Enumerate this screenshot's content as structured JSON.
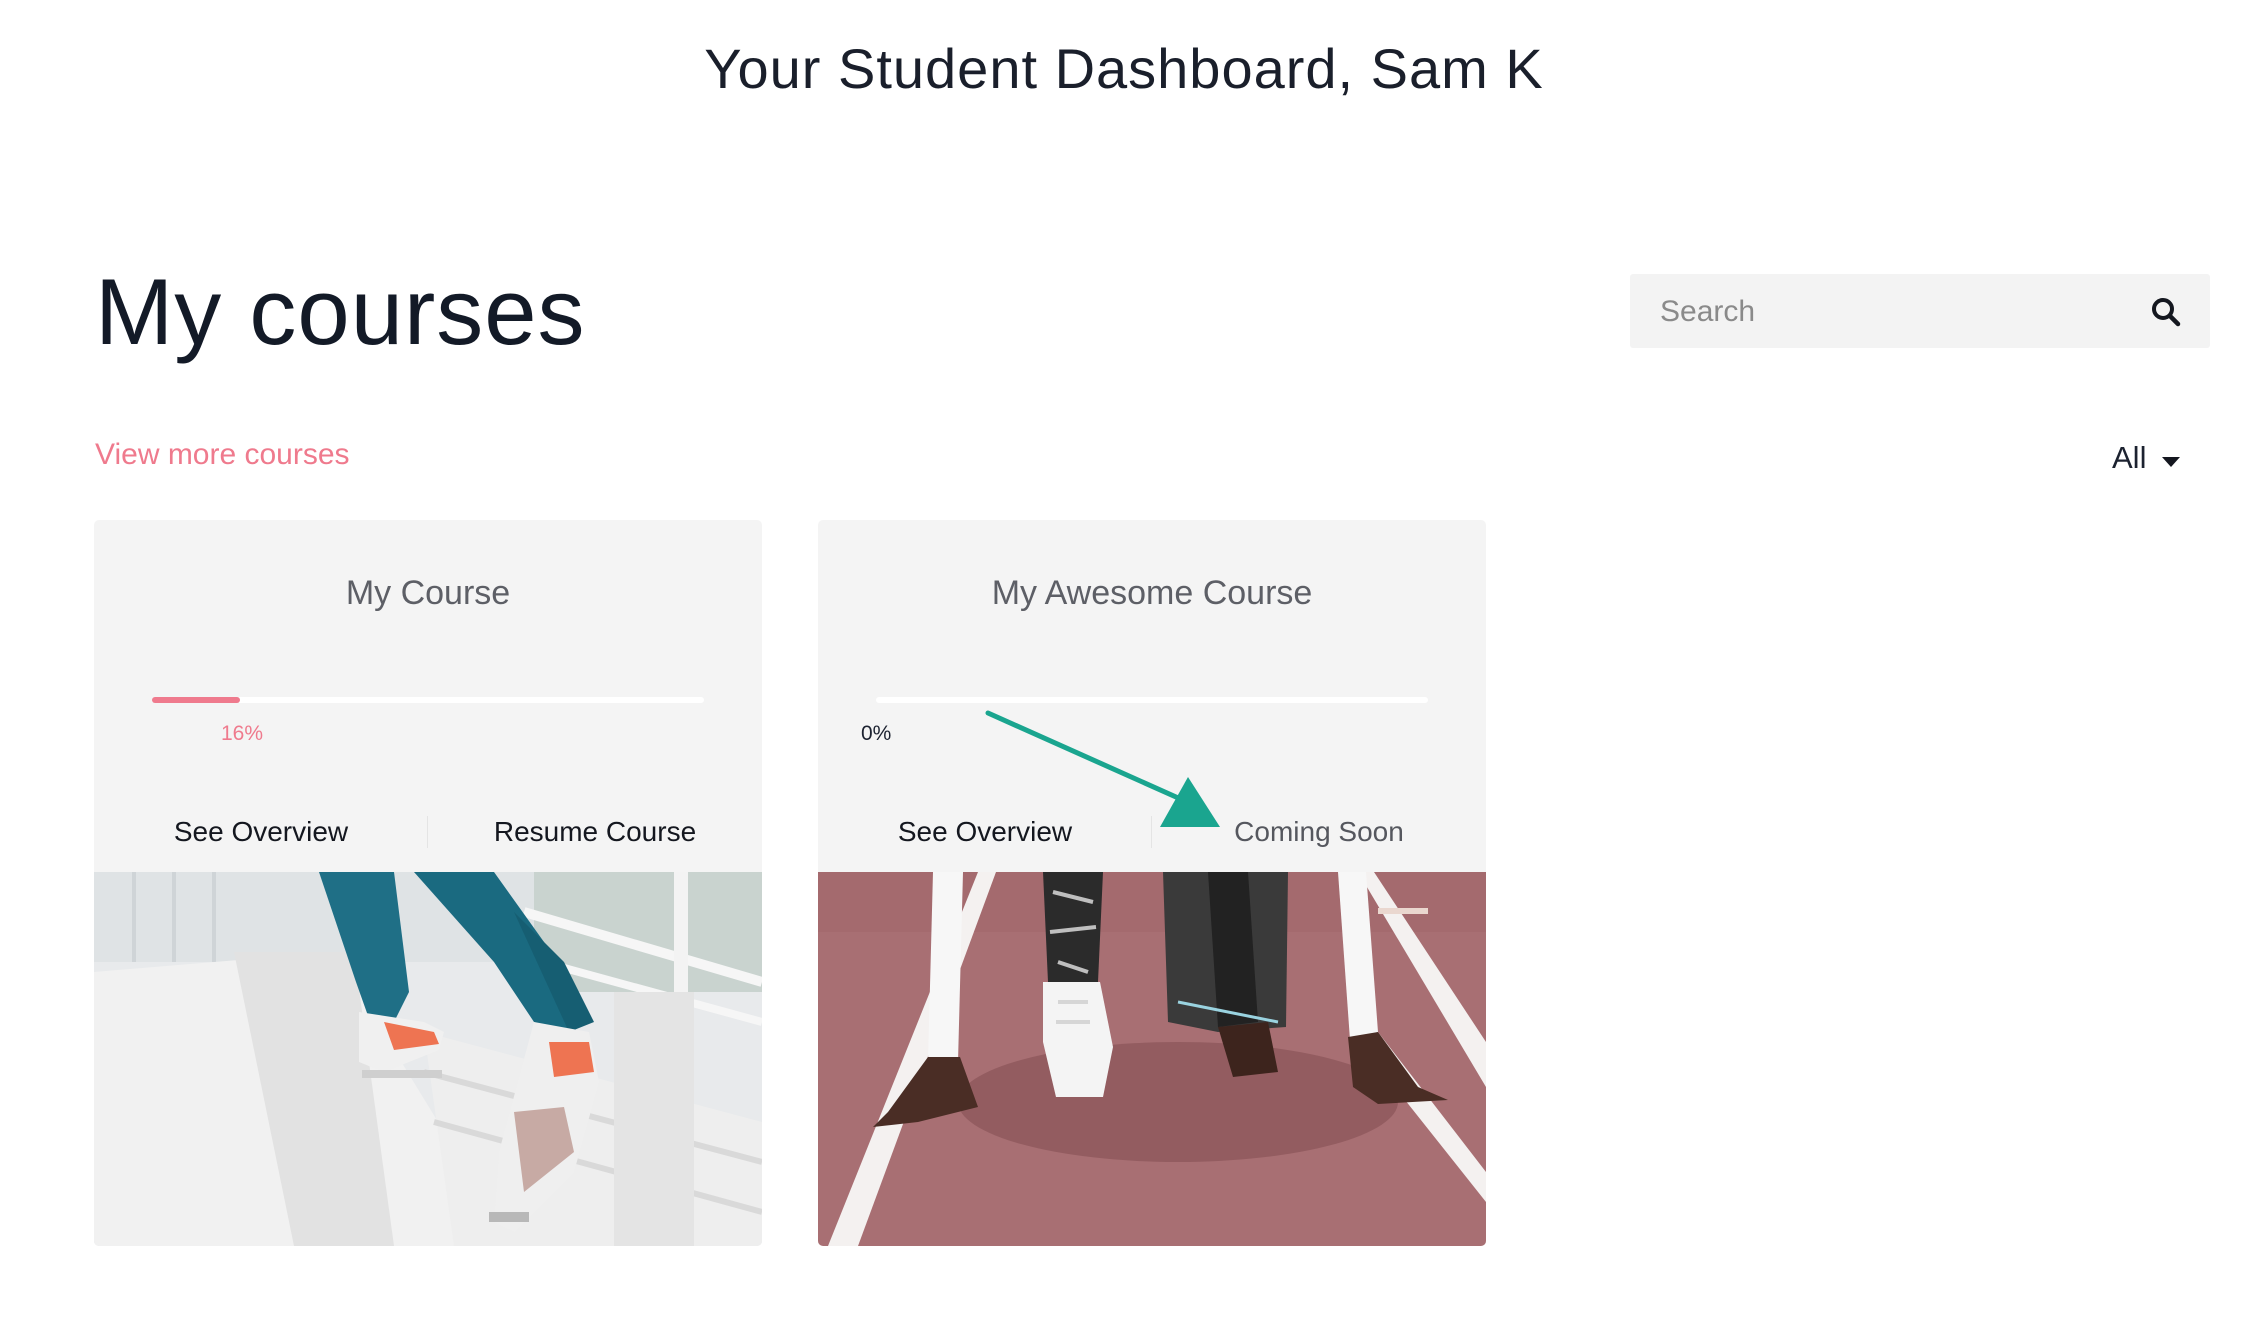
{
  "header": {
    "title": "Your Student Dashboard, Sam K"
  },
  "section": {
    "title": "My courses",
    "view_more_label": "View more courses"
  },
  "search": {
    "placeholder": "Search",
    "icon": "search-icon"
  },
  "filter": {
    "selected": "All",
    "icon": "caret-down-icon"
  },
  "courses": [
    {
      "title": "My Course",
      "progress_percent": 16,
      "progress_label": "16%",
      "primary_action": "See Overview",
      "secondary_action": "Resume Course",
      "image": "athlete legs climbing stadium stairs in teal leggings and orange sneakers"
    },
    {
      "title": "My Awesome Course",
      "progress_percent": 0,
      "progress_label": "0%",
      "primary_action": "See Overview",
      "secondary_action": "Coming Soon",
      "image": "sprinter in starting blocks on red running track"
    }
  ],
  "annotation": {
    "icon": "arrow-pointer-icon",
    "color": "#1aa58f"
  },
  "colors": {
    "accent": "#ef7a8d",
    "card_bg": "#f4f4f4",
    "search_bg": "#f3f3f3"
  }
}
